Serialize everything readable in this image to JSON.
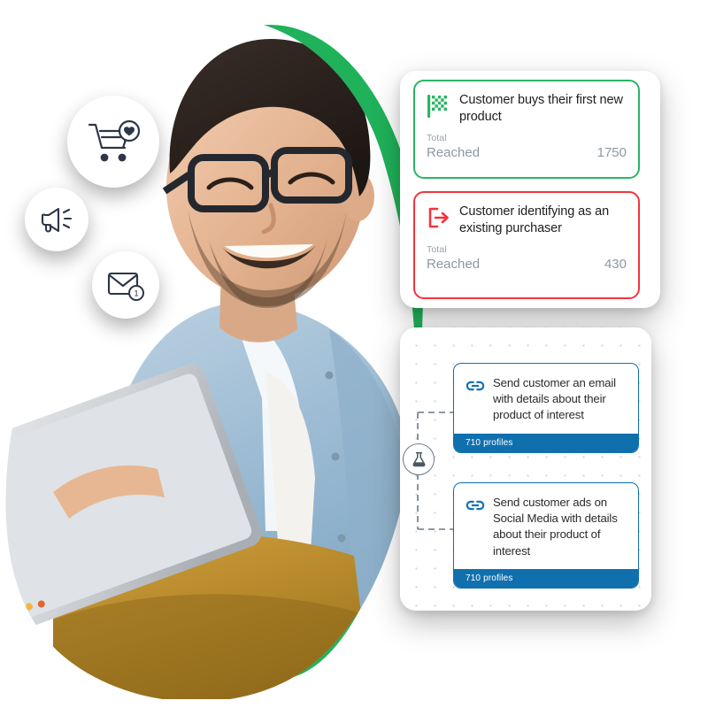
{
  "scene": {
    "background_color": "#ffffff",
    "blob_color": "#1fb25a",
    "photo_alt": "Smiling man with glasses and denim shirt holding a tablet"
  },
  "floating_icons": [
    {
      "name": "cart-heart-icon",
      "label": "Shopping cart with heart"
    },
    {
      "name": "megaphone-icon",
      "label": "Megaphone"
    },
    {
      "name": "envelope-badge-icon",
      "label": "Envelope with notification",
      "badge": "1"
    }
  ],
  "triggers_panel": {
    "cards": [
      {
        "icon": "checkered-flag-icon",
        "accent_color": "#2bb463",
        "title": "Customer buys their first new product",
        "total_label": "Total",
        "metric_label": "Reached",
        "metric_value": "1750"
      },
      {
        "icon": "exit-arrow-icon",
        "accent_color": "#f5333f",
        "title": "Customer identifying as an existing purchaser",
        "total_label": "Total",
        "metric_label": "Reached",
        "metric_value": "430"
      }
    ]
  },
  "flow_panel": {
    "split_node": {
      "icon": "flask-icon",
      "label": "A/B split test"
    },
    "accent_color": "#0f6fb0",
    "footer_color": "#1070ae",
    "steps": [
      {
        "icon": "link-icon",
        "text": "Send customer an email with details about their product of interest",
        "profiles": "710 profiles"
      },
      {
        "icon": "link-icon",
        "text": "Send customer ads on Social Media with details about their product of interest",
        "profiles": "710 profiles"
      }
    ]
  }
}
